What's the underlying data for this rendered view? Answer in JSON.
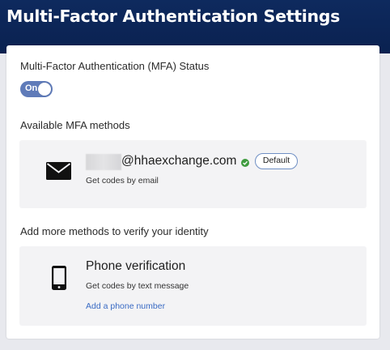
{
  "header": {
    "title": "Multi-Factor Authentication Settings"
  },
  "status": {
    "label": "Multi-Factor Authentication (MFA) Status",
    "toggle_text": "On"
  },
  "available": {
    "heading": "Available MFA methods",
    "email_method": {
      "icon": "envelope-icon",
      "address_domain": "@hhaexchange.com",
      "verified_icon": "check-circle-icon",
      "verified_color": "#3f9b3f",
      "badge": "Default",
      "description": "Get codes by email"
    }
  },
  "add_more": {
    "heading": "Add more methods to verify your identity",
    "phone_method": {
      "icon": "smartphone-icon",
      "title": "Phone verification",
      "description": "Get codes by text message",
      "link": "Add a phone number"
    }
  },
  "colors": {
    "header_bg": "#0a2150",
    "toggle_on": "#5f7bb9",
    "link": "#3a6bc4",
    "card_bg": "#f3f3f5"
  }
}
